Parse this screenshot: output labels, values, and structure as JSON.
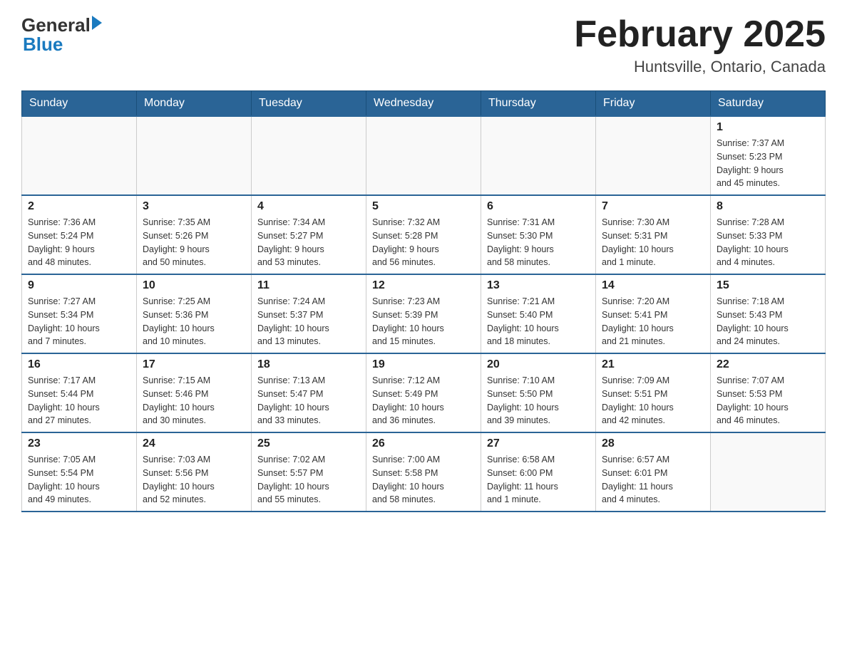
{
  "header": {
    "logo_general": "General",
    "logo_blue": "Blue",
    "month_title": "February 2025",
    "location": "Huntsville, Ontario, Canada"
  },
  "days_of_week": [
    "Sunday",
    "Monday",
    "Tuesday",
    "Wednesday",
    "Thursday",
    "Friday",
    "Saturday"
  ],
  "weeks": [
    [
      {
        "day": "",
        "info": ""
      },
      {
        "day": "",
        "info": ""
      },
      {
        "day": "",
        "info": ""
      },
      {
        "day": "",
        "info": ""
      },
      {
        "day": "",
        "info": ""
      },
      {
        "day": "",
        "info": ""
      },
      {
        "day": "1",
        "info": "Sunrise: 7:37 AM\nSunset: 5:23 PM\nDaylight: 9 hours\nand 45 minutes."
      }
    ],
    [
      {
        "day": "2",
        "info": "Sunrise: 7:36 AM\nSunset: 5:24 PM\nDaylight: 9 hours\nand 48 minutes."
      },
      {
        "day": "3",
        "info": "Sunrise: 7:35 AM\nSunset: 5:26 PM\nDaylight: 9 hours\nand 50 minutes."
      },
      {
        "day": "4",
        "info": "Sunrise: 7:34 AM\nSunset: 5:27 PM\nDaylight: 9 hours\nand 53 minutes."
      },
      {
        "day": "5",
        "info": "Sunrise: 7:32 AM\nSunset: 5:28 PM\nDaylight: 9 hours\nand 56 minutes."
      },
      {
        "day": "6",
        "info": "Sunrise: 7:31 AM\nSunset: 5:30 PM\nDaylight: 9 hours\nand 58 minutes."
      },
      {
        "day": "7",
        "info": "Sunrise: 7:30 AM\nSunset: 5:31 PM\nDaylight: 10 hours\nand 1 minute."
      },
      {
        "day": "8",
        "info": "Sunrise: 7:28 AM\nSunset: 5:33 PM\nDaylight: 10 hours\nand 4 minutes."
      }
    ],
    [
      {
        "day": "9",
        "info": "Sunrise: 7:27 AM\nSunset: 5:34 PM\nDaylight: 10 hours\nand 7 minutes."
      },
      {
        "day": "10",
        "info": "Sunrise: 7:25 AM\nSunset: 5:36 PM\nDaylight: 10 hours\nand 10 minutes."
      },
      {
        "day": "11",
        "info": "Sunrise: 7:24 AM\nSunset: 5:37 PM\nDaylight: 10 hours\nand 13 minutes."
      },
      {
        "day": "12",
        "info": "Sunrise: 7:23 AM\nSunset: 5:39 PM\nDaylight: 10 hours\nand 15 minutes."
      },
      {
        "day": "13",
        "info": "Sunrise: 7:21 AM\nSunset: 5:40 PM\nDaylight: 10 hours\nand 18 minutes."
      },
      {
        "day": "14",
        "info": "Sunrise: 7:20 AM\nSunset: 5:41 PM\nDaylight: 10 hours\nand 21 minutes."
      },
      {
        "day": "15",
        "info": "Sunrise: 7:18 AM\nSunset: 5:43 PM\nDaylight: 10 hours\nand 24 minutes."
      }
    ],
    [
      {
        "day": "16",
        "info": "Sunrise: 7:17 AM\nSunset: 5:44 PM\nDaylight: 10 hours\nand 27 minutes."
      },
      {
        "day": "17",
        "info": "Sunrise: 7:15 AM\nSunset: 5:46 PM\nDaylight: 10 hours\nand 30 minutes."
      },
      {
        "day": "18",
        "info": "Sunrise: 7:13 AM\nSunset: 5:47 PM\nDaylight: 10 hours\nand 33 minutes."
      },
      {
        "day": "19",
        "info": "Sunrise: 7:12 AM\nSunset: 5:49 PM\nDaylight: 10 hours\nand 36 minutes."
      },
      {
        "day": "20",
        "info": "Sunrise: 7:10 AM\nSunset: 5:50 PM\nDaylight: 10 hours\nand 39 minutes."
      },
      {
        "day": "21",
        "info": "Sunrise: 7:09 AM\nSunset: 5:51 PM\nDaylight: 10 hours\nand 42 minutes."
      },
      {
        "day": "22",
        "info": "Sunrise: 7:07 AM\nSunset: 5:53 PM\nDaylight: 10 hours\nand 46 minutes."
      }
    ],
    [
      {
        "day": "23",
        "info": "Sunrise: 7:05 AM\nSunset: 5:54 PM\nDaylight: 10 hours\nand 49 minutes."
      },
      {
        "day": "24",
        "info": "Sunrise: 7:03 AM\nSunset: 5:56 PM\nDaylight: 10 hours\nand 52 minutes."
      },
      {
        "day": "25",
        "info": "Sunrise: 7:02 AM\nSunset: 5:57 PM\nDaylight: 10 hours\nand 55 minutes."
      },
      {
        "day": "26",
        "info": "Sunrise: 7:00 AM\nSunset: 5:58 PM\nDaylight: 10 hours\nand 58 minutes."
      },
      {
        "day": "27",
        "info": "Sunrise: 6:58 AM\nSunset: 6:00 PM\nDaylight: 11 hours\nand 1 minute."
      },
      {
        "day": "28",
        "info": "Sunrise: 6:57 AM\nSunset: 6:01 PM\nDaylight: 11 hours\nand 4 minutes."
      },
      {
        "day": "",
        "info": ""
      }
    ]
  ]
}
